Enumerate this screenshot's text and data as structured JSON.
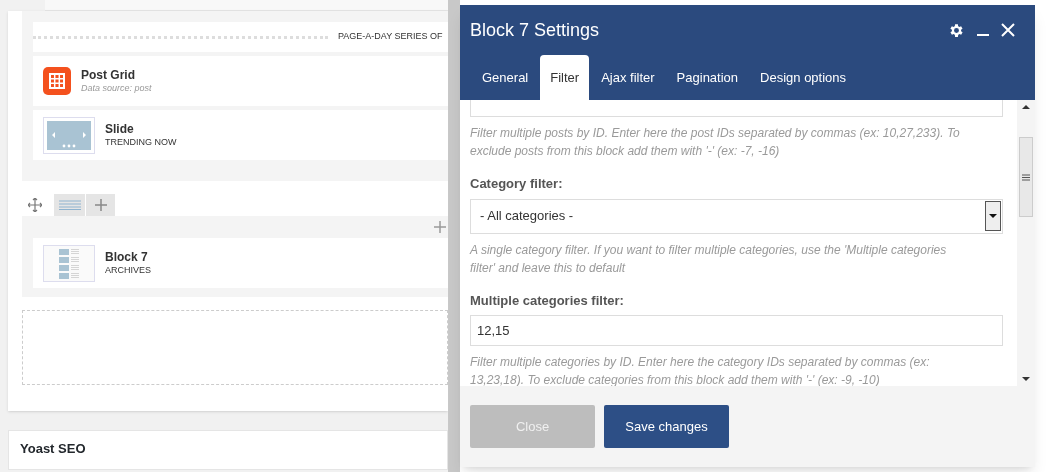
{
  "builder": {
    "separator": {
      "title": "PAGE-A-DAY SERIES OF"
    },
    "elements": [
      {
        "kind": "post_grid",
        "name": "Post Grid",
        "subtitle": "Data source: post"
      },
      {
        "kind": "slide",
        "name": "Slide",
        "subtitle": "TRENDING NOW"
      }
    ],
    "row_elements": [
      {
        "kind": "block",
        "name": "Block 7",
        "subtitle": "ARCHIVES"
      }
    ]
  },
  "yoast": {
    "title": "Yoast SEO"
  },
  "modal": {
    "title": "Block 7 Settings",
    "tabs": [
      {
        "label": "General",
        "selected": false
      },
      {
        "label": "Filter",
        "selected": true
      },
      {
        "label": "Ajax filter",
        "selected": false
      },
      {
        "label": "Pagination",
        "selected": false
      },
      {
        "label": "Design options",
        "selected": false
      }
    ],
    "fields": [
      {
        "kind": "help",
        "text": "Filter multiple posts by ID. Enter here the post IDs separated by commas (ex: 10,27,233). To exclude posts from this block add them with '-' (ex: -7, -16)"
      },
      {
        "kind": "label",
        "text": "Category filter:"
      },
      {
        "kind": "select",
        "value": "- All categories -"
      },
      {
        "kind": "help",
        "text": "A single category filter. If you want to filter multiple categories, use the 'Multiple categories filter' and leave this to default"
      },
      {
        "kind": "label",
        "text": "Multiple categories filter:"
      },
      {
        "kind": "input",
        "value": "12,15"
      },
      {
        "kind": "help",
        "text": "Filter multiple categories by ID. Enter here the category IDs separated by commas (ex: 13,23,18). To exclude categories from this block add them with '-' (ex: -9, -10)"
      }
    ],
    "buttons": [
      {
        "kind": "secondary",
        "label": "Close"
      },
      {
        "kind": "primary",
        "label": "Save changes"
      }
    ]
  }
}
